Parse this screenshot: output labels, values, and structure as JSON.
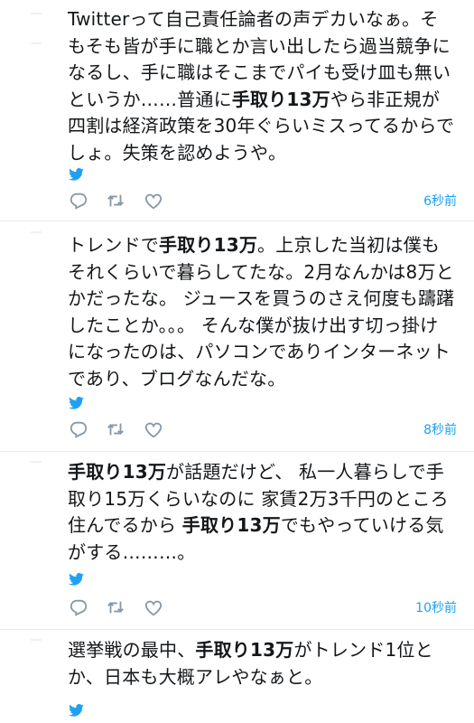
{
  "tweets": [
    {
      "segments": [
        {
          "t": "Twitterって自己責任論者の声デカいなぁ。そもそも皆が手に職とか言い出したら過当競争になるし、手に職はそこまでパイも受け皿も無いというか……普通に",
          "b": false
        },
        {
          "t": "手取り13万",
          "b": true
        },
        {
          "t": "やら非正規が四割は経済政策を30年ぐらいミスってるからでしょ。失策を認めようや。",
          "b": false
        }
      ],
      "time": "6秒前"
    },
    {
      "segments": [
        {
          "t": "トレンドで",
          "b": false
        },
        {
          "t": "手取り13万",
          "b": true
        },
        {
          "t": "。上京した当初は僕もそれくらいで暮らしてたな。2月なんかは8万とかだったな。 ジュースを買うのさえ何度も躊躇したことか。。。 そんな僕が抜け出す切っ掛けになったのは、パソコンでありインターネットであり、ブログなんだな。",
          "b": false
        }
      ],
      "time": "8秒前"
    },
    {
      "segments": [
        {
          "t": "手取り13万",
          "b": true
        },
        {
          "t": "が話題だけど、 私一人暮らしで手取り15万くらいなのに 家賃2万3千円のところ住んでるから ",
          "b": false
        },
        {
          "t": "手取り13万",
          "b": true
        },
        {
          "t": "でもやっていける気がする………。",
          "b": false
        }
      ],
      "time": "10秒前"
    },
    {
      "segments": [
        {
          "t": "選挙戦の最中、",
          "b": false
        },
        {
          "t": "手取り13万",
          "b": true
        },
        {
          "t": "がトレンド1位とか、日本も大概アレやなぁと。",
          "b": false
        }
      ],
      "time": ""
    }
  ],
  "colors": {
    "accent": "#1da1f2",
    "icon": "#8899a6",
    "divider": "#e6ecf0"
  },
  "icons": [
    "twitter-bird-icon",
    "reply-icon",
    "retweet-icon",
    "like-icon"
  ]
}
